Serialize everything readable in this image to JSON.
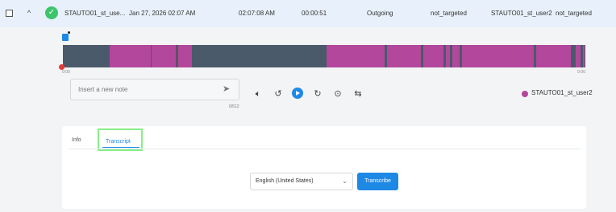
{
  "row": {
    "chevron": "^",
    "status_icon": "check-circle",
    "name": "STAUTO01_st_use...",
    "datetime": "Jan 27, 2026 02:07 AM",
    "time": "02:07:08 AM",
    "duration": "00:00:51",
    "direction": "Outgoing",
    "targeted": "not_targeted",
    "user": "STAUTO01_st_user2",
    "targeted2": "not_targeted"
  },
  "player": {
    "time_start": "0:00",
    "time_end": "0:00",
    "note_placeholder": "Insert a new note",
    "note_counter": "0/512",
    "speaker_name": "STAUTO01_st_user2",
    "colors": {
      "accent": "#1e88e5",
      "speaker": "#b3479c",
      "wave_bg": "#4a5a6a",
      "playhead": "#e53935",
      "success": "#3ec46d"
    },
    "icons": [
      "volume-icon",
      "rewind-5-icon",
      "play-icon",
      "forward-5-icon",
      "speed-icon",
      "swap-icon"
    ]
  },
  "tabs": {
    "info": "Info",
    "transcript": "Transcript"
  },
  "transcribe": {
    "language": "English (United States)",
    "button": "Transcribe"
  }
}
